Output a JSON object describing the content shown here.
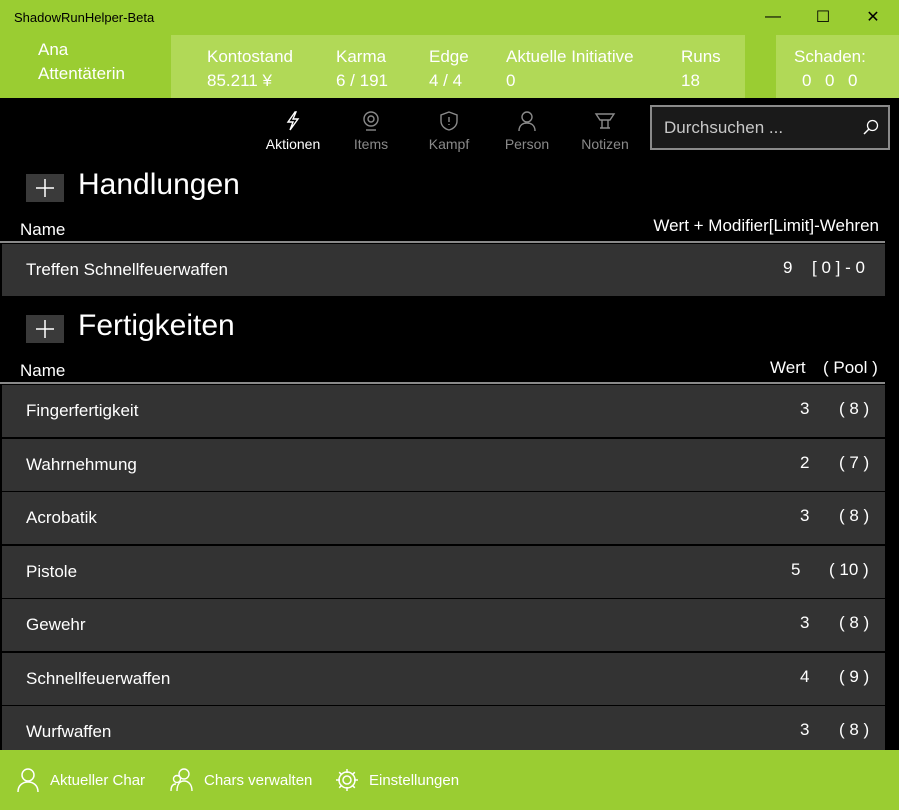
{
  "window": {
    "title": "ShadowRunHelper-Beta",
    "minimize": "—",
    "maximize": "☐",
    "close": "✕"
  },
  "character": {
    "first": "Ana",
    "last": "Attentäterin"
  },
  "stats": [
    {
      "label": "Kontostand",
      "value": "85.211 ¥"
    },
    {
      "label": "Karma",
      "value": "6 / 191"
    },
    {
      "label": "Edge",
      "value": "4 / 4"
    },
    {
      "label": "Aktuelle Initiative",
      "value": "0"
    },
    {
      "label": "Runs",
      "value": "18"
    }
  ],
  "damage": {
    "label": "Schaden:",
    "values": [
      "0",
      "0",
      "0"
    ]
  },
  "nav": [
    {
      "label": "Aktionen",
      "icon": "lightning-icon",
      "active": true
    },
    {
      "label": "Items",
      "icon": "webcam-icon",
      "active": false
    },
    {
      "label": "Kampf",
      "icon": "shield-icon",
      "active": false
    },
    {
      "label": "Person",
      "icon": "person-icon",
      "active": false
    },
    {
      "label": "Notizen",
      "icon": "notes-icon",
      "active": false
    }
  ],
  "search": {
    "placeholder": "Durchsuchen ..."
  },
  "handlungen": {
    "title": "Handlungen",
    "col_name": "Name",
    "col_value": "Wert + Modifier[Limit]-Wehren",
    "rows": [
      {
        "name": "Treffen Schnellfeuerwaffen",
        "value": "9",
        "extra": "[ 0 ] - 0"
      }
    ]
  },
  "fertigkeiten": {
    "title": "Fertigkeiten",
    "col_name": "Name",
    "col_value": "Wert",
    "col_pool": "( Pool )",
    "rows": [
      {
        "name": "Fingerfertigkeit",
        "value": "3",
        "pool": "( 8 )"
      },
      {
        "name": "Wahrnehmung",
        "value": "2",
        "pool": "( 7 )"
      },
      {
        "name": "Acrobatik",
        "value": "3",
        "pool": "( 8 )"
      },
      {
        "name": "Pistole",
        "value": "5",
        "pool": "( 10 )"
      },
      {
        "name": "Gewehr",
        "value": "3",
        "pool": "( 8 )"
      },
      {
        "name": "Schnellfeuerwaffen",
        "value": "4",
        "pool": "( 9 )"
      },
      {
        "name": "Wurfwaffen",
        "value": "3",
        "pool": "( 8 )"
      }
    ]
  },
  "bottom": [
    {
      "label": "Aktueller Char",
      "icon": "person-icon"
    },
    {
      "label": "Chars verwalten",
      "icon": "people-icon"
    },
    {
      "label": "Einstellungen",
      "icon": "gear-icon"
    }
  ],
  "colors": {
    "accent": "#9acd32",
    "accent_light": "#b1d957",
    "row_bg": "#333333",
    "nav_inactive": "#8a8a8a"
  }
}
